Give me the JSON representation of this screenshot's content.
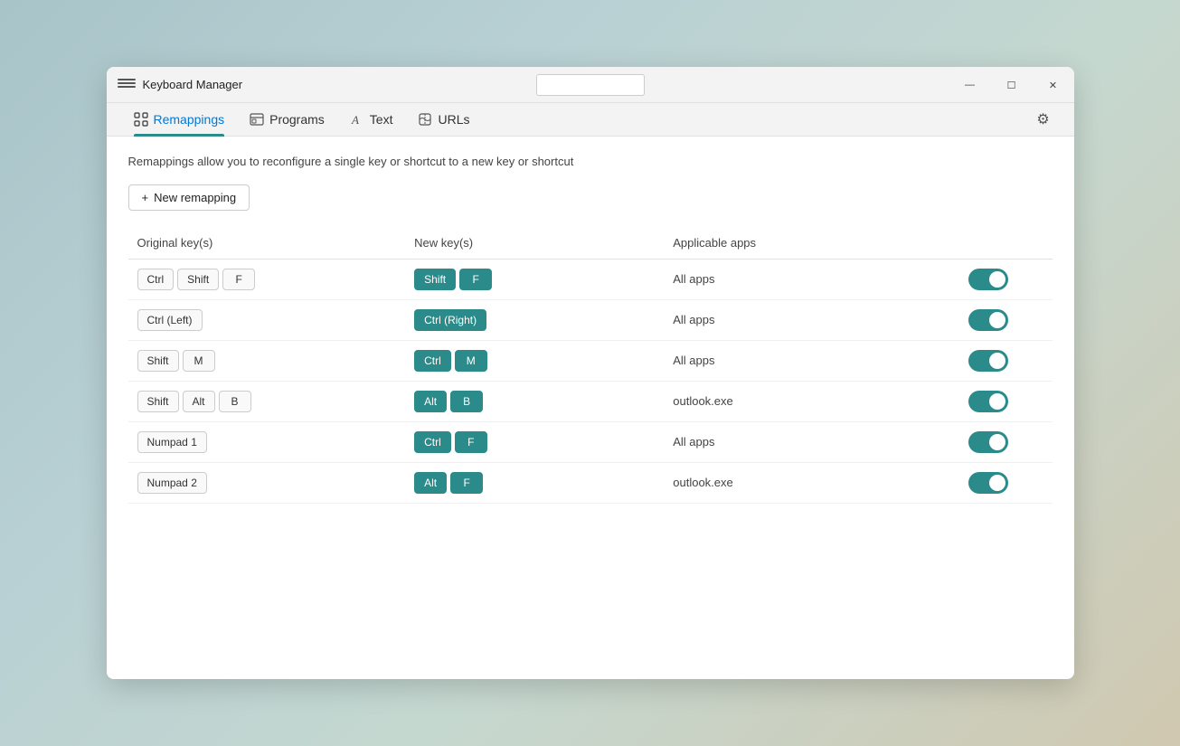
{
  "window": {
    "title": "Keyboard Manager",
    "controls": {
      "minimize": "—",
      "maximize": "☐",
      "close": "✕"
    }
  },
  "tabs": [
    {
      "id": "remappings",
      "label": "Remappings",
      "active": true
    },
    {
      "id": "programs",
      "label": "Programs",
      "active": false
    },
    {
      "id": "text",
      "label": "Text",
      "active": false
    },
    {
      "id": "urls",
      "label": "URLs",
      "active": false
    }
  ],
  "description": "Remappings allow you to reconfigure a single key or shortcut to a new key or shortcut",
  "new_remapping_btn": "+ New remapping",
  "table": {
    "headers": [
      "Original key(s)",
      "New key(s)",
      "Applicable apps"
    ],
    "rows": [
      {
        "original": [
          "Ctrl",
          "Shift",
          "F"
        ],
        "new": [
          {
            "label": "Shift",
            "filled": true
          },
          {
            "label": "F",
            "filled": true
          }
        ],
        "app": "All apps",
        "enabled": true
      },
      {
        "original": [
          "Ctrl (Left)"
        ],
        "new": [
          {
            "label": "Ctrl (Right)",
            "filled": true
          }
        ],
        "app": "All apps",
        "enabled": true
      },
      {
        "original": [
          "Shift",
          "M"
        ],
        "new": [
          {
            "label": "Ctrl",
            "filled": true
          },
          {
            "label": "M",
            "filled": true
          }
        ],
        "app": "All apps",
        "enabled": true
      },
      {
        "original": [
          "Shift",
          "Alt",
          "B"
        ],
        "new": [
          {
            "label": "Alt",
            "filled": true
          },
          {
            "label": "B",
            "filled": true
          }
        ],
        "app": "outlook.exe",
        "enabled": true
      },
      {
        "original": [
          "Numpad 1"
        ],
        "new": [
          {
            "label": "Ctrl",
            "filled": true
          },
          {
            "label": "F",
            "filled": true
          }
        ],
        "app": "All apps",
        "enabled": true
      },
      {
        "original": [
          "Numpad 2"
        ],
        "new": [
          {
            "label": "Alt",
            "filled": true
          },
          {
            "label": "F",
            "filled": true
          }
        ],
        "app": "outlook.exe",
        "enabled": true
      }
    ]
  },
  "settings_icon": "⚙",
  "search_placeholder": ""
}
